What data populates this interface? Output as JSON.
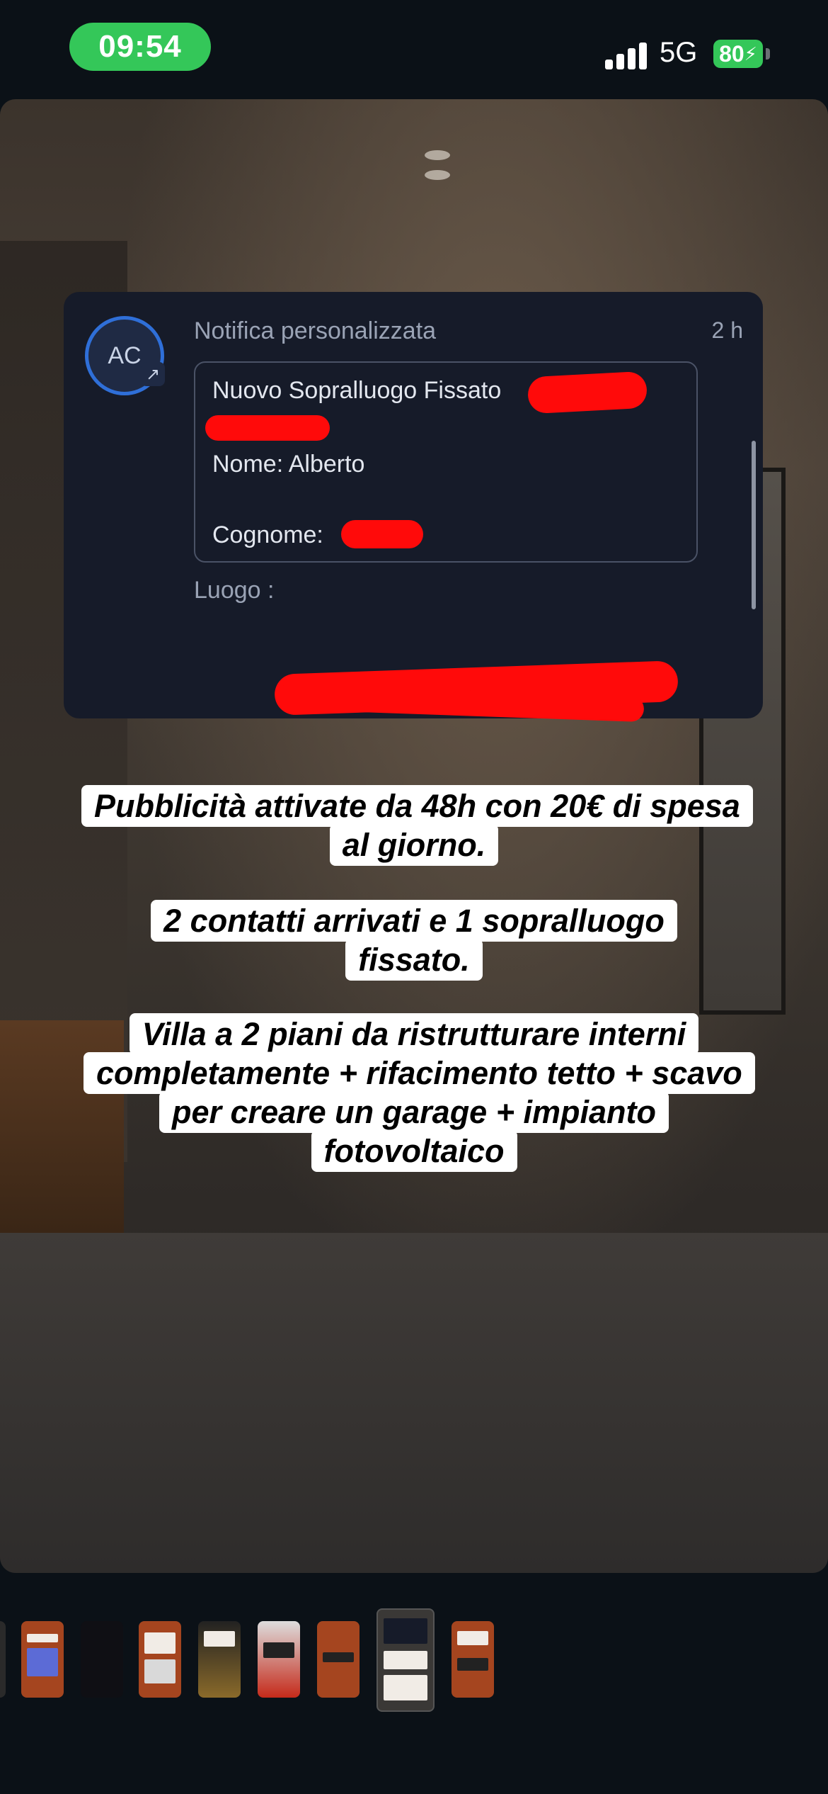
{
  "status_bar": {
    "time": "09:54",
    "network": "5G",
    "battery": "80"
  },
  "notification": {
    "avatar_initials": "AC",
    "title": "Notifica personalizzata",
    "time_ago": "2 h",
    "body_line_1": "Nuovo Sopralluogo Fissato",
    "body_line_3": "Nome: Alberto",
    "body_line_5": "Cognome:",
    "footer_label": "Luogo :"
  },
  "captions": {
    "caption_1": "Pubblicità attivate da 48h con 20€ di spesa al giorno.",
    "caption_2": "2 contatti arrivati e 1 sopralluogo fissato.",
    "caption_3": "Villa a 2 piani da ristrutturare interni completamente + rifacimento tetto + scavo per creare un garage + impianto fotovoltaico"
  },
  "colors": {
    "status_pill": "#34c759",
    "redaction": "#ff0a0a",
    "notification_bg": "#161b29",
    "avatar_ring": "#2f6fd8"
  },
  "thumbnails": {
    "count": 9,
    "active_index": 7
  }
}
